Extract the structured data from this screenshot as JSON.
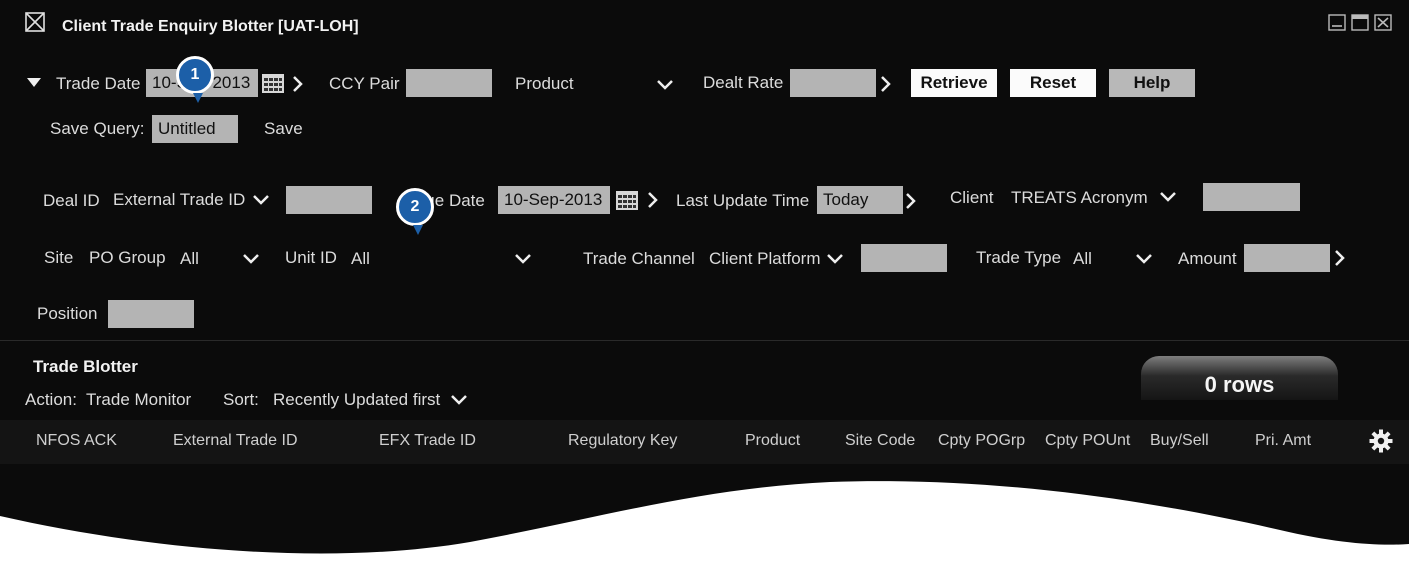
{
  "window": {
    "title": "Client Trade Enquiry Blotter [UAT-LOH]"
  },
  "filters": {
    "trade_date_label": "Trade Date",
    "trade_date_value": "10-Sep-2013",
    "ccy_pair_label": "CCY Pair",
    "product_label": "Product",
    "dealt_rate_label": "Dealt Rate",
    "retrieve_label": "Retrieve",
    "reset_label": "Reset",
    "help_label": "Help",
    "save_query_label": "Save Query:",
    "save_query_value": "Untitled",
    "save_label": "Save",
    "deal_id_label": "Deal ID",
    "deal_id_type": "External Trade ID",
    "value_date_label": "Value Date",
    "value_date_value": "10-Sep-2013",
    "last_update_label": "Last Update Time",
    "last_update_value": "Today",
    "client_label": "Client",
    "client_type": "TREATS Acronym",
    "site_label": "Site",
    "po_group_label": "PO Group",
    "po_group_value": "All",
    "unit_id_label": "Unit ID",
    "unit_id_value": "All",
    "trade_channel_label": "Trade Channel",
    "trade_channel_value": "Client Platform",
    "trade_type_label": "Trade Type",
    "trade_type_value": "All",
    "amount_label": "Amount",
    "position_label": "Position"
  },
  "blotter": {
    "title": "Trade Blotter",
    "action_label": "Action:",
    "action_value": "Trade Monitor",
    "sort_label": "Sort:",
    "sort_value": "Recently Updated first",
    "rows_badge": "0 rows",
    "columns": [
      "NFOS ACK",
      "External Trade ID",
      "EFX Trade ID",
      "Regulatory Key",
      "Product",
      "Site Code",
      "Cpty POGrp",
      "Cpty POUnt",
      "Buy/Sell",
      "Pri. Amt"
    ]
  },
  "callouts": [
    "1",
    "2"
  ],
  "icons": [
    "close-x-icon",
    "minimize-icon",
    "maximize-icon",
    "calendar-icon",
    "chevron-down-icon",
    "chevron-right-icon",
    "collapse-triangle-icon",
    "gear-icon"
  ]
}
